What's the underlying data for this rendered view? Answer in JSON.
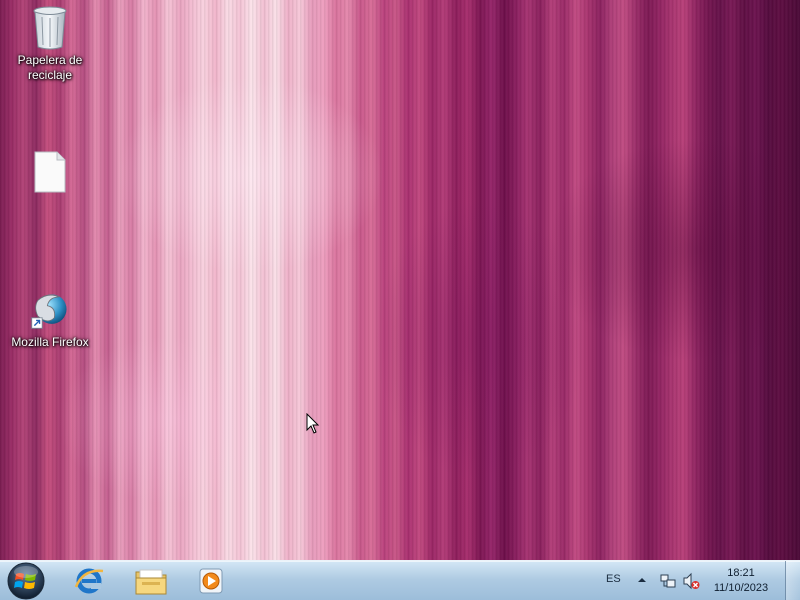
{
  "desktop": {
    "icons": [
      {
        "id": "recycle-bin",
        "label": "Papelera de reciclaje",
        "icon": "recycle-bin-icon"
      },
      {
        "id": "blank-file",
        "label": "",
        "icon": "document-icon"
      },
      {
        "id": "firefox",
        "label": "Mozilla Firefox",
        "icon": "firefox-icon"
      }
    ]
  },
  "taskbar": {
    "start_icon": "windows-start-orb-icon",
    "pinned": [
      {
        "name": "Internet Explorer",
        "icon": "internet-explorer-icon"
      },
      {
        "name": "Explorador de Windows",
        "icon": "folder-icon"
      },
      {
        "name": "Windows Media Player",
        "icon": "media-player-icon"
      }
    ]
  },
  "tray": {
    "language": "ES",
    "time": "18:21",
    "date": "11/10/2023",
    "icons": [
      "show-hidden-icons-arrow",
      "network-icon",
      "volume-muted-icon"
    ]
  },
  "colors": {
    "taskbar": "#aac8e1",
    "wallpaper_accent": "#c24b83"
  }
}
